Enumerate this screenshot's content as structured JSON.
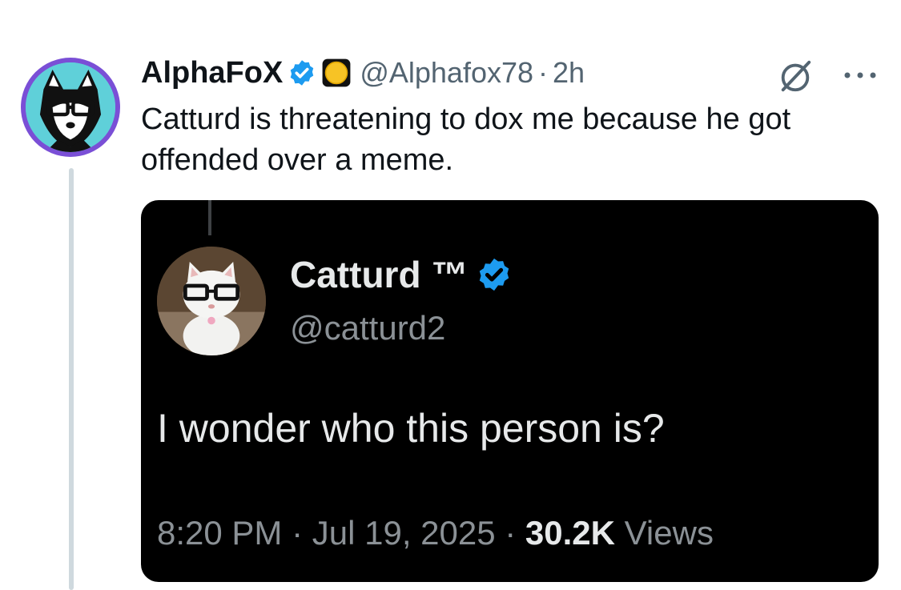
{
  "tweet": {
    "author": {
      "display_name": "AlphaFoX",
      "handle": "@Alphafox78",
      "avatar_icon": "fox-with-glasses-avatar",
      "badges": [
        "verified-badge-icon",
        "yellow-circle-emoji"
      ]
    },
    "separator": "·",
    "time": "2h",
    "text": "Catturd is threatening to dox me because he got offended over a meme.",
    "actions": {
      "grok_icon": "grok-icon",
      "more_icon": "more-icon"
    }
  },
  "embedded_screenshot": {
    "author": {
      "display_name": "Catturd ™",
      "handle": "@catturd2",
      "avatar_icon": "white-cat-with-glasses-avatar",
      "badge": "verified-badge-icon"
    },
    "text": "I wonder who this person is?",
    "timestamp": "8:20 PM · Jul 19, 2025",
    "separator": " · ",
    "views_count": "30.2K",
    "views_label": " Views"
  },
  "colors": {
    "verified_blue": "#1d9bf0",
    "text_primary": "#0f1419",
    "text_secondary": "#536471",
    "thread_line": "#cfd9de",
    "media_background": "#000000"
  }
}
